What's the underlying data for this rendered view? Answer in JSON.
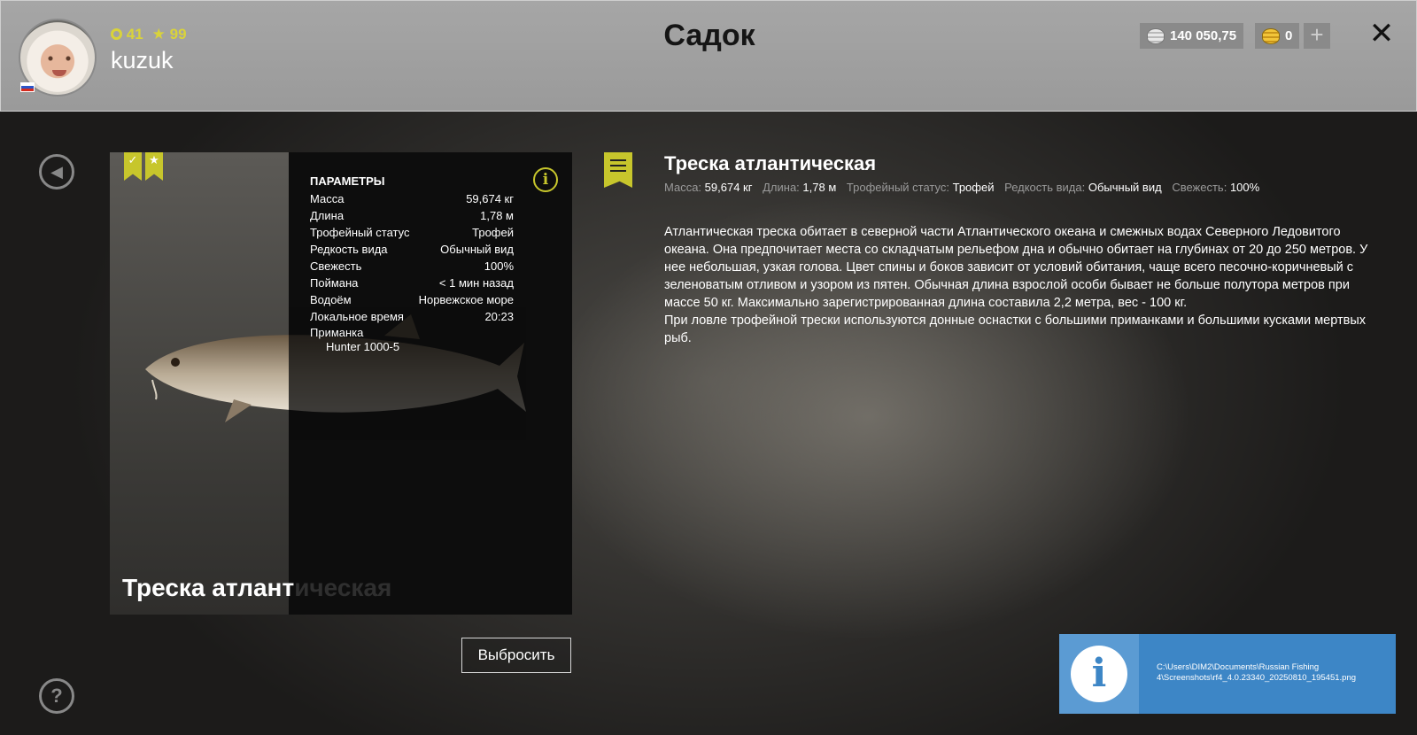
{
  "header": {
    "level": "41",
    "rank": "99",
    "username": "kuzuk",
    "title": "Садок",
    "silver": "140 050,75",
    "gold": "0"
  },
  "card": {
    "params_title": "ПАРАМЕТРЫ",
    "params": [
      {
        "label": "Масса",
        "value": "59,674 кг"
      },
      {
        "label": "Длина",
        "value": "1,78 м"
      },
      {
        "label": "Трофейный статус",
        "value": "Трофей"
      },
      {
        "label": "Редкость вида",
        "value": "Обычный вид"
      },
      {
        "label": "Свежесть",
        "value": "100%"
      },
      {
        "label": "Поймана",
        "value": "< 1 мин назад"
      },
      {
        "label": "Водоём",
        "value": "Норвежское море"
      },
      {
        "label": "Локальное время",
        "value": "20:23"
      }
    ],
    "bait_label": "Приманка",
    "bait_value": "Hunter 1000-5",
    "name_visible": "Треска атлант",
    "name_faded": "ическая"
  },
  "actions": {
    "discard": "Выбросить"
  },
  "details": {
    "title": "Треска атлантическая",
    "meta": [
      {
        "label": "Масса:",
        "value": "59,674 кг"
      },
      {
        "label": "Длина:",
        "value": "1,78 м"
      },
      {
        "label": "Трофейный статус:",
        "value": "Трофей"
      },
      {
        "label": "Редкость вида:",
        "value": "Обычный вид"
      },
      {
        "label": "Свежесть:",
        "value": "100%"
      }
    ],
    "description_1": "Атлантическая треска обитает в северной части Атлантического океана и смежных водах Северного Ледовитого океана. Она предпочитает места со складчатым рельефом дна и обычно обитает на глубинах от 20 до 250 метров. У нее небольшая, узкая голова. Цвет спины и боков зависит от условий обитания, чаще всего песочно-коричневый с зеленоватым отливом и узором из пятен. Обычная длина взрослой особи бывает не больше полутора метров при массе 50 кг. Максимально зарегистрированная длина составила 2,2 метра, вес - 100 кг.",
    "description_2": "При ловле трофейной трески используются донные оснастки с большими приманками и большими кусками мертвых рыб."
  },
  "notification": {
    "path": "C:\\Users\\DIM2\\Documents\\Russian Fishing 4\\Screenshots\\rf4_4.0.23340_20250810_195451.png"
  },
  "icons": {
    "back": "back-icon",
    "help": "help-icon",
    "close": "close-icon",
    "info": "info-icon",
    "description": "document-icon"
  },
  "colors": {
    "accent": "#c7c62c",
    "header_bg": "#a0a0a0",
    "notification_bg": "#3d86c6"
  }
}
